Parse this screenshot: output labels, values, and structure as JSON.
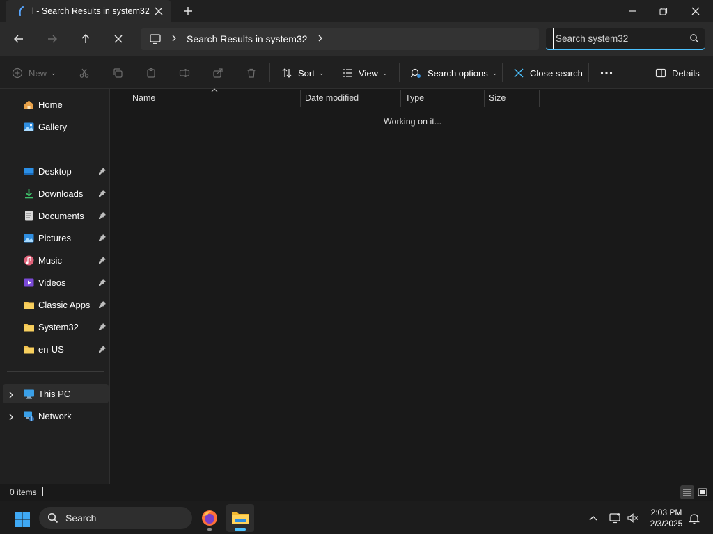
{
  "window": {
    "tab_title": "l - Search Results in system32",
    "tab_icon": "search-tab-icon",
    "controls": [
      "minimize-icon",
      "restore-icon",
      "close-icon"
    ]
  },
  "nav": {
    "breadcrumb": [
      "Search Results in system32"
    ],
    "search": {
      "value": "",
      "placeholder": "Search system32"
    }
  },
  "commands": {
    "new_label": "New",
    "sort_label": "Sort",
    "view_label": "View",
    "search_options_label": "Search options",
    "close_search_label": "Close search",
    "details_label": "Details"
  },
  "sidebar": {
    "top": [
      {
        "label": "Home",
        "icon": "home-icon"
      },
      {
        "label": "Gallery",
        "icon": "gallery-icon"
      }
    ],
    "pinned": [
      {
        "label": "Desktop",
        "icon": "desktop-icon"
      },
      {
        "label": "Downloads",
        "icon": "downloads-icon"
      },
      {
        "label": "Documents",
        "icon": "documents-icon"
      },
      {
        "label": "Pictures",
        "icon": "pictures-icon"
      },
      {
        "label": "Music",
        "icon": "music-icon"
      },
      {
        "label": "Videos",
        "icon": "videos-icon"
      },
      {
        "label": "Classic Apps",
        "icon": "folder-icon"
      },
      {
        "label": "System32",
        "icon": "folder-icon"
      },
      {
        "label": "en-US",
        "icon": "folder-icon"
      }
    ],
    "locations": [
      {
        "label": "This PC",
        "icon": "this-pc-icon",
        "selected": true
      },
      {
        "label": "Network",
        "icon": "network-icon",
        "selected": false
      }
    ]
  },
  "content": {
    "columns": [
      "Name",
      "Date modified",
      "Type",
      "Size"
    ],
    "status_message": "Working on it..."
  },
  "statusbar": {
    "item_count": "0 items"
  },
  "taskbar": {
    "search_label": "Search",
    "time": "2:03 PM",
    "date": "2/3/2025"
  },
  "colors": {
    "accent": "#4cc2ff",
    "background": "#191919",
    "panel": "#202020"
  }
}
